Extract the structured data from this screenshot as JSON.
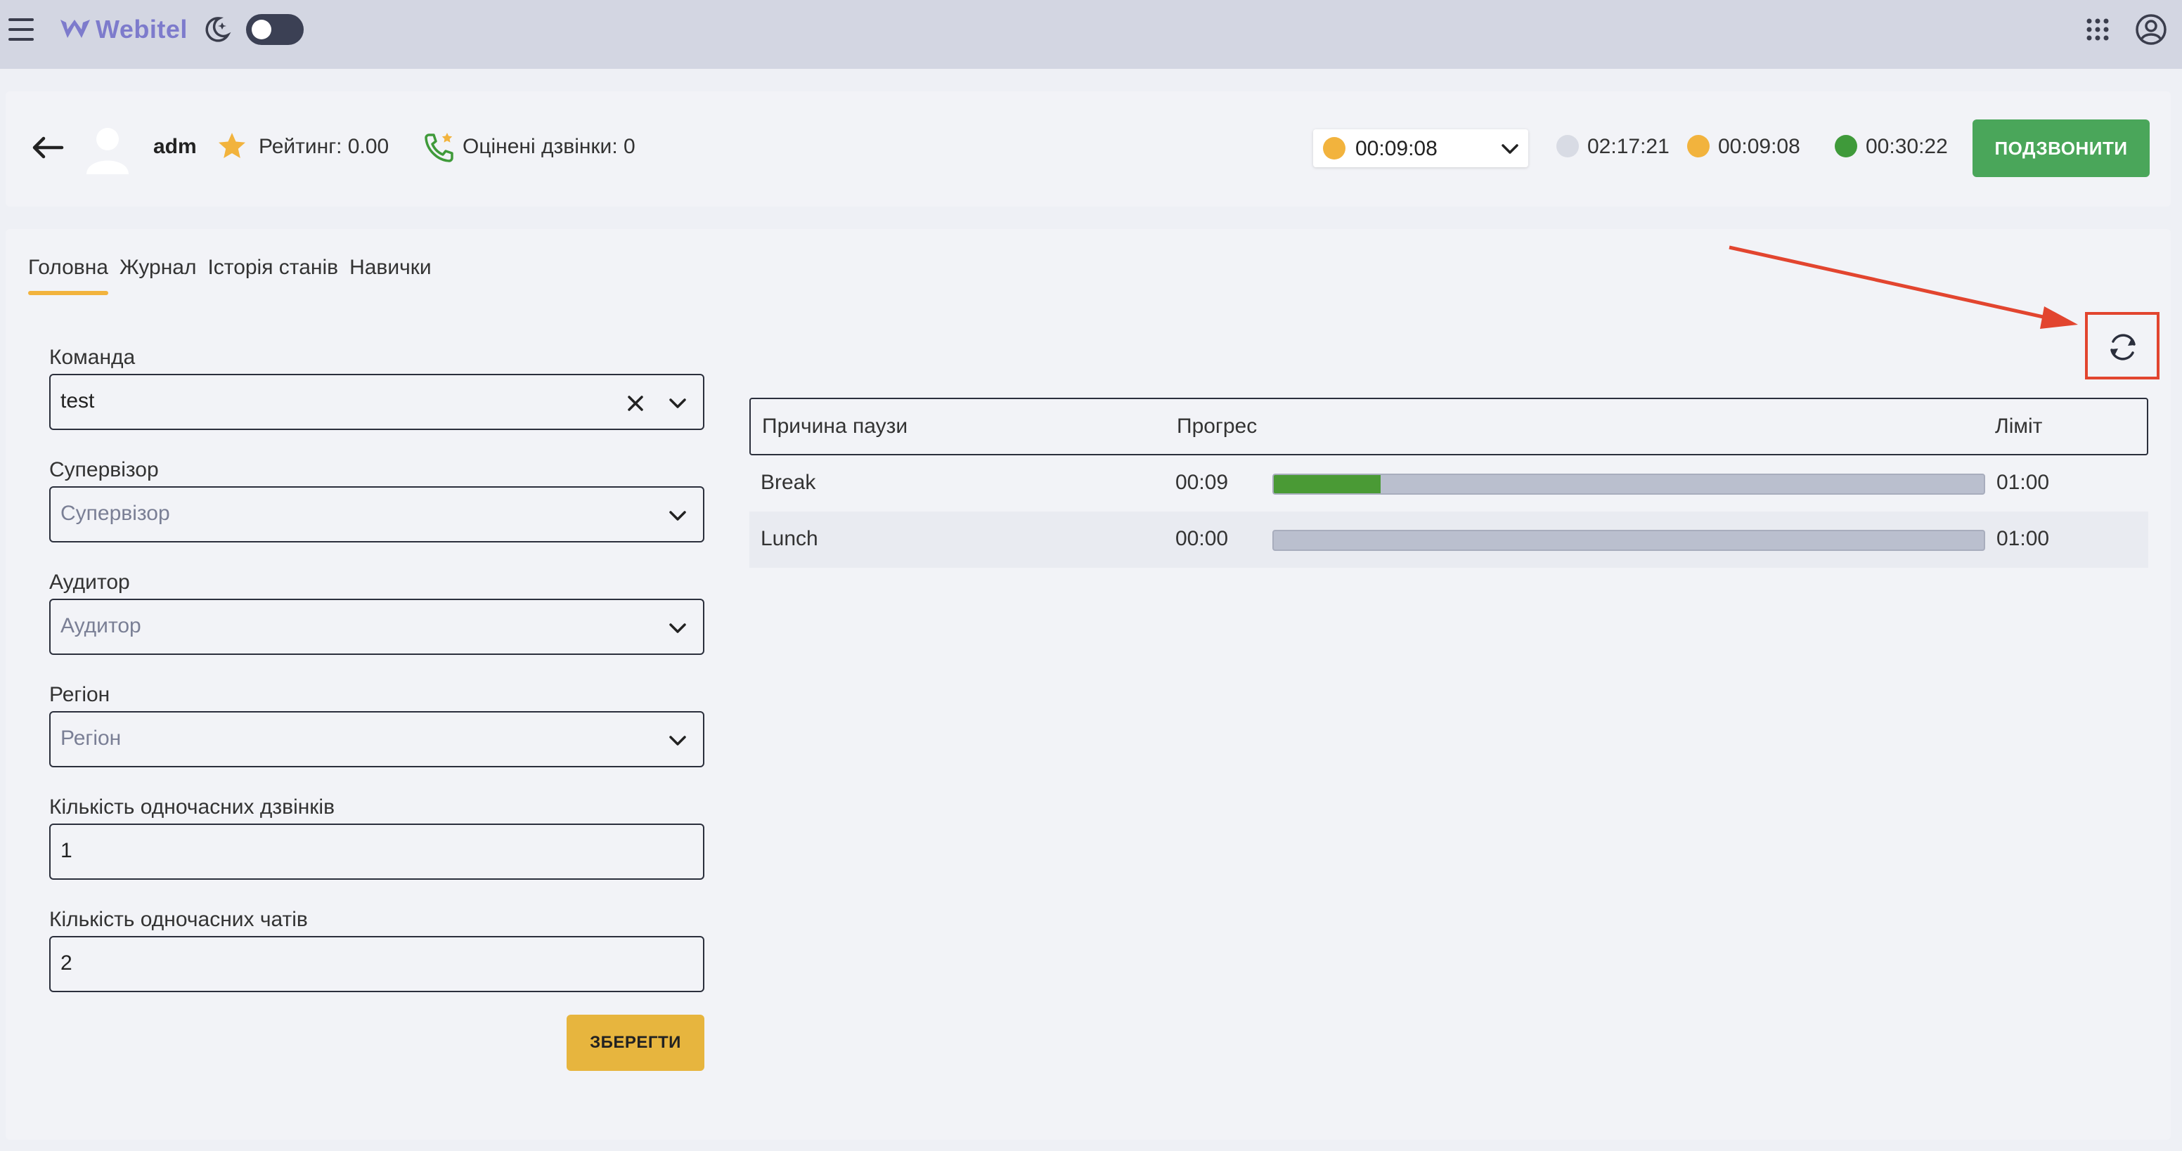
{
  "app": {
    "name": "Webitel",
    "theme_toggle_state": "off"
  },
  "agent": {
    "name": "adm",
    "rating": "Рейтинг: 0.00",
    "rated_calls": "Оцінені дзвінки: 0"
  },
  "status": {
    "current_timer": "00:09:08",
    "current_color": "#f2b33d",
    "timers": [
      {
        "value": "02:17:21",
        "color": "#d8dbe4"
      },
      {
        "value": "00:09:08",
        "color": "#f2b33d"
      },
      {
        "value": "00:30:22",
        "color": "#3f9a3a"
      }
    ],
    "call_button": "ПОДЗВОНИТИ"
  },
  "tabs": [
    {
      "label": "Головна",
      "active": true
    },
    {
      "label": "Журнал",
      "active": false
    },
    {
      "label": "Історія станів",
      "active": false
    },
    {
      "label": "Навички",
      "active": false
    }
  ],
  "form": {
    "team": {
      "label": "Команда",
      "value": "test"
    },
    "supervisor": {
      "label": "Супервізор",
      "placeholder": "Супервізор"
    },
    "auditor": {
      "label": "Аудитор",
      "placeholder": "Аудитор"
    },
    "region": {
      "label": "Регіон",
      "placeholder": "Регіон"
    },
    "concurrent_calls": {
      "label": "Кількість одночасних дзвінків",
      "value": "1"
    },
    "concurrent_chats": {
      "label": "Кількість одночасних чатів",
      "value": "2"
    },
    "save_button": "ЗБЕРЕГТИ"
  },
  "pause_table": {
    "headers": {
      "reason": "Причина паузи",
      "progress": "Прогрес",
      "limit": "Ліміт"
    },
    "rows": [
      {
        "reason": "Break",
        "elapsed": "00:09",
        "progress_fraction": 0.15,
        "limit": "01:00"
      },
      {
        "reason": "Lunch",
        "elapsed": "00:00",
        "progress_fraction": 0.0,
        "limit": "01:00"
      }
    ]
  },
  "icons": {
    "menu": "hamburger-icon",
    "logo": "webitel-logo-icon",
    "theme": "moon-icon",
    "apps": "apps-grid-icon",
    "account": "user-circle-icon",
    "back": "back-arrow-icon",
    "avatar": "avatar-icon",
    "rating": "star-icon",
    "rated_calls": "phone-star-icon",
    "refresh": "refresh-icon"
  },
  "annotation": {
    "highlight_color": "#e2452f"
  }
}
